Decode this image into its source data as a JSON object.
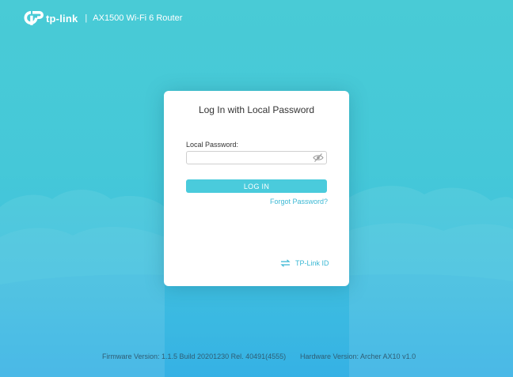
{
  "header": {
    "brand": "tp-link",
    "separator": "|",
    "model": "AX1500 Wi-Fi 6 Router",
    "logo_icon": "tp-link-logo-icon"
  },
  "login": {
    "title": "Log In with Local Password",
    "password_label": "Local Password:",
    "password_value": "",
    "password_placeholder": "",
    "toggle_icon": "eye-slash-icon",
    "login_button": "LOG IN",
    "forgot_link": "Forgot Password?",
    "tplink_id_icon": "switch-arrows-icon",
    "tplink_id_link": "TP-Link ID"
  },
  "footer": {
    "firmware": "Firmware Version:  1.1.5 Build 20201230 Rel. 40491(4555)",
    "hardware": "Hardware Version: Archer AX10 v1.0"
  },
  "colors": {
    "background_top": "#49cbd6",
    "background_bottom": "#36b3e6",
    "accent": "#4acbdc",
    "link": "#3bb8d4",
    "card": "#ffffff"
  }
}
